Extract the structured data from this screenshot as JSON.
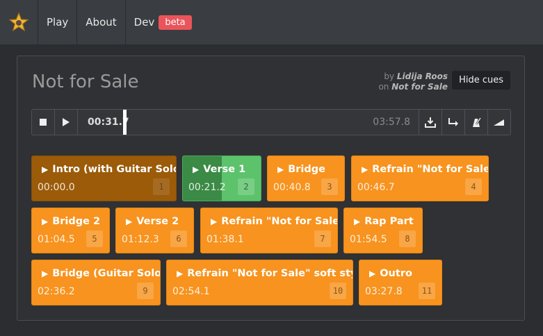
{
  "nav": {
    "items": [
      {
        "label": "Play"
      },
      {
        "label": "About"
      },
      {
        "label": "Dev"
      }
    ],
    "badge": "beta"
  },
  "track": {
    "title": "Not for Sale",
    "by_label": "by",
    "artist": "Lidija Roos",
    "on_label": "on",
    "album": "Not for Sale"
  },
  "hide_cues_label": "Hide cues",
  "player": {
    "current_time": "00:31.7",
    "total_time": "03:57.8",
    "progress": 0.133
  },
  "cues": [
    {
      "name": "Intro (with Guitar Solo)",
      "time": "00:00.0",
      "num": "1",
      "state": "played"
    },
    {
      "name": "Verse 1",
      "time": "00:21.2",
      "num": "2",
      "state": "active",
      "progress": 0.5
    },
    {
      "name": "Bridge",
      "time": "00:40.8",
      "num": "3",
      "state": "upcoming"
    },
    {
      "name": "Refrain \"Not for Sale\"",
      "time": "00:46.7",
      "num": "4",
      "state": "upcoming"
    },
    {
      "name": "Bridge 2",
      "time": "01:04.5",
      "num": "5",
      "state": "upcoming"
    },
    {
      "name": "Verse 2",
      "time": "01:12.3",
      "num": "6",
      "state": "upcoming"
    },
    {
      "name": "Refrain \"Not for Sale\"",
      "time": "01:38.1",
      "num": "7",
      "state": "upcoming"
    },
    {
      "name": "Rap Part",
      "time": "01:54.5",
      "num": "8",
      "state": "upcoming"
    },
    {
      "name": "Bridge (Guitar Solo)",
      "time": "02:36.2",
      "num": "9",
      "state": "upcoming"
    },
    {
      "name": "Refrain \"Not for Sale\" soft style",
      "time": "02:54.1",
      "num": "10",
      "state": "upcoming"
    },
    {
      "name": "Outro",
      "time": "03:27.8",
      "num": "11",
      "state": "upcoming"
    }
  ],
  "colors": {
    "cue": "#f7931e",
    "played": "#9c5b09",
    "active": "#5cc26b",
    "active_fill": "#3b8a46",
    "beta_badge": "#e9555b"
  },
  "icons": [
    "star-logo-icon",
    "stop-icon",
    "play-icon",
    "download-icon",
    "return-icon",
    "metronome-icon",
    "volume-icon"
  ]
}
